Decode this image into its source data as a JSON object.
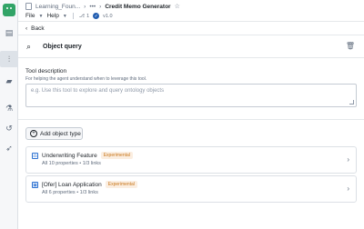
{
  "header": {
    "breadcrumb_folder": "Learning_Foun...",
    "more": "•••",
    "title": "Credit Memo Generator",
    "menus": [
      "File",
      "Help"
    ],
    "count": "1",
    "version": "v1.0"
  },
  "back_label": "Back",
  "section": {
    "title": "Object query"
  },
  "tool_description": {
    "label": "Tool description",
    "help": "For helping the agent understand when to leverage this tool.",
    "placeholder": "e.g. Use this tool to explore and query ontology objects"
  },
  "add_object_type_label": "Add object type",
  "object_types": [
    {
      "name": "Underwriting Feature",
      "tag": "Experimental",
      "meta": "All 10 properties • 1/3 links"
    },
    {
      "name": "[Ofer] Loan Application",
      "tag": "Experimental",
      "meta": "All 6 properties • 1/3 links"
    }
  ],
  "colors": {
    "accent": "#2d72d2",
    "experimental": "#c87619",
    "logo": "#32a467"
  }
}
